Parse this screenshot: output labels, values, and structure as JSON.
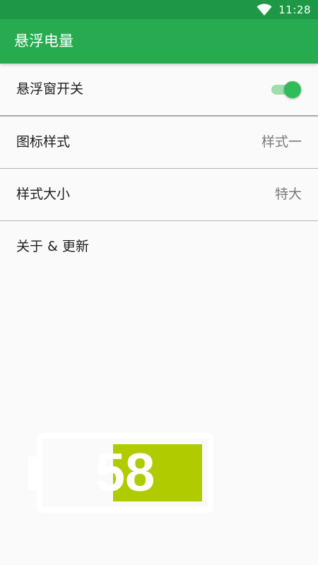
{
  "status_bar": {
    "time": "11:28",
    "background": "#1e9847"
  },
  "app_bar": {
    "title": "悬浮电量",
    "background": "#27ab50"
  },
  "settings": [
    {
      "label": "悬浮窗开关",
      "control": "toggle",
      "on": true
    },
    {
      "label": "图标样式",
      "value": "样式一"
    },
    {
      "label": "样式大小",
      "value": "特大"
    },
    {
      "label": "关于 & 更新"
    }
  ],
  "battery_preview": {
    "level": 58,
    "fill_color": "#b0cc00"
  }
}
